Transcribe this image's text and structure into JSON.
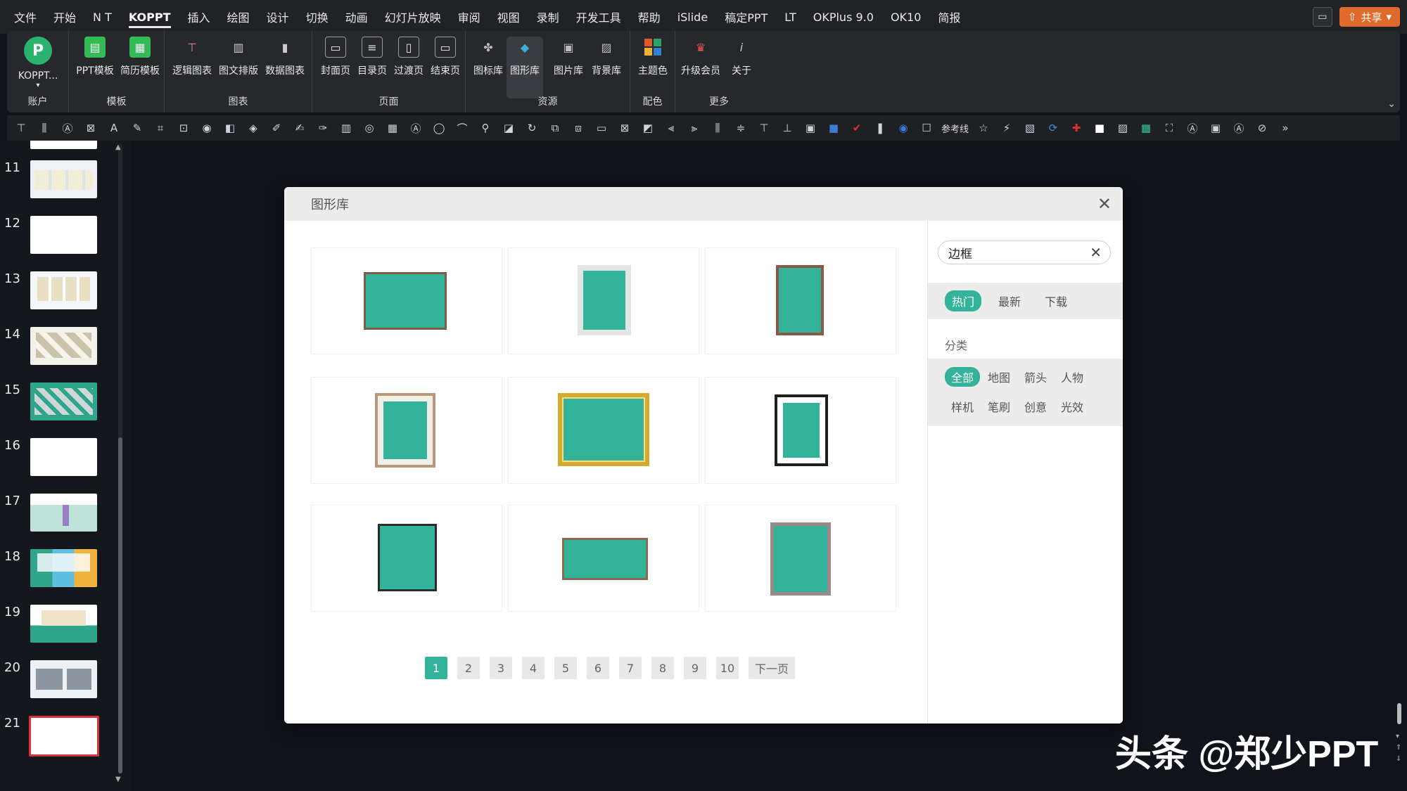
{
  "menubar": {
    "items": [
      "文件",
      "开始",
      "N T",
      "KOPPT",
      "插入",
      "绘图",
      "设计",
      "切换",
      "动画",
      "幻灯片放映",
      "审阅",
      "视图",
      "录制",
      "开发工具",
      "帮助",
      "iSlide",
      "稿定PPT",
      "LT",
      "OKPlus 9.0",
      "OK10",
      "简报"
    ],
    "active": "KOPPT",
    "share_label": "共享"
  },
  "ribbon": {
    "groups": [
      {
        "label": "账户",
        "buttons": [
          "KOPPT..."
        ]
      },
      {
        "label": "模板",
        "buttons": [
          "PPT模板",
          "简历模板"
        ]
      },
      {
        "label": "图表",
        "buttons": [
          "逻辑图表",
          "图文排版",
          "数据图表"
        ]
      },
      {
        "label": "页面",
        "buttons": [
          "封面页",
          "目录页",
          "过渡页",
          "结束页"
        ]
      },
      {
        "label": "资源",
        "buttons": [
          "图标库",
          "图形库",
          "图片库",
          "背景库"
        ]
      },
      {
        "label": "配色",
        "buttons": [
          "主题色"
        ]
      },
      {
        "label": "更多",
        "buttons": [
          "升级会员",
          "关于"
        ]
      }
    ],
    "logo_letter": "P"
  },
  "quickbar": {
    "reference_label": "参考线"
  },
  "thumbnails": {
    "numbers": [
      "11",
      "12",
      "13",
      "14",
      "15",
      "16",
      "17",
      "18",
      "19",
      "20",
      "21"
    ],
    "current": "21"
  },
  "dialog": {
    "title": "图形库",
    "close_glyph": "✕",
    "pages": [
      "1",
      "2",
      "3",
      "4",
      "5",
      "6",
      "7",
      "8",
      "9",
      "10"
    ],
    "active_page": "1",
    "next_label": "下一页",
    "search": {
      "value": "边框"
    },
    "sort_tabs": [
      "热门",
      "最新",
      "下载"
    ],
    "active_sort": "热门",
    "category_label": "分类",
    "categories": [
      "全部",
      "地图",
      "箭头",
      "人物",
      "样机",
      "笔刷",
      "创意",
      "光效"
    ],
    "active_category": "全部",
    "accent": "#33b39a"
  },
  "watermark": "头条 @郑少PPT"
}
